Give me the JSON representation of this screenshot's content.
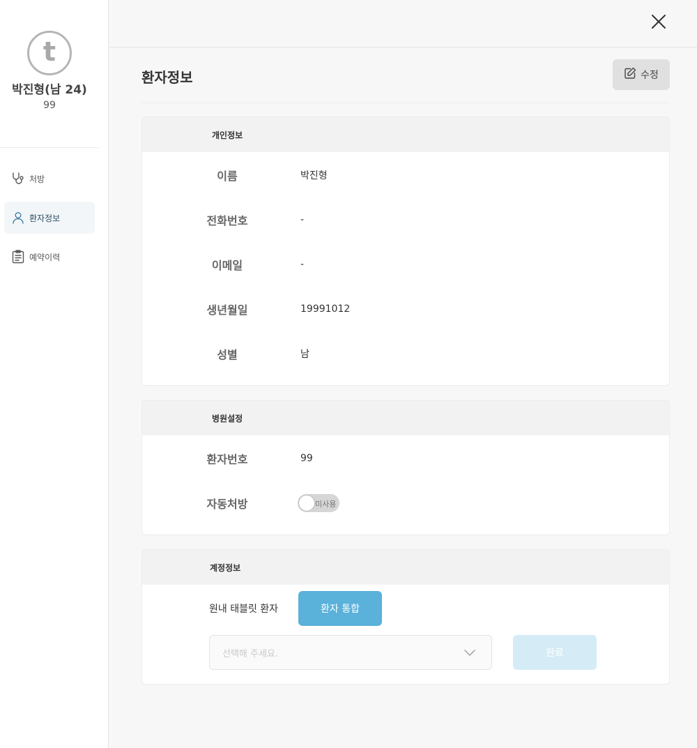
{
  "sidebar": {
    "avatar_letter": "t",
    "patient_name": "박진형(남 24)",
    "patient_number": "99",
    "items": [
      {
        "label": "처방",
        "icon": "stethoscope-icon",
        "active": false
      },
      {
        "label": "환자정보",
        "icon": "user-icon",
        "active": true
      },
      {
        "label": "예약이력",
        "icon": "clipboard-icon",
        "active": false
      }
    ]
  },
  "header": {
    "close_icon": "close-icon"
  },
  "main": {
    "title": "환자정보",
    "edit_label": "수정",
    "personal": {
      "header": "개인정보",
      "rows": [
        {
          "key": "이름",
          "value": "박진형"
        },
        {
          "key": "전화번호",
          "value": "-"
        },
        {
          "key": "이메일",
          "value": "-"
        },
        {
          "key": "생년월일",
          "value": "19991012"
        },
        {
          "key": "성별",
          "value": "남"
        }
      ]
    },
    "hospital": {
      "header": "병원설정",
      "patient_no_key": "환자번호",
      "patient_no_value": "99",
      "auto_rx_key": "자동처방",
      "auto_rx_toggle": "미사용",
      "auto_rx_enabled": false
    },
    "account": {
      "header": "계정정보",
      "label": "원내 태블릿 환자",
      "merge_button": "환자 통합",
      "select_placeholder": "선택해 주세요.",
      "done_button": "완료"
    }
  },
  "colors": {
    "accent": "#5ab1da",
    "accent_disabled": "#d5ecf6",
    "active_nav_text": "#2a4e66",
    "active_icon": "#3b7ea5"
  }
}
